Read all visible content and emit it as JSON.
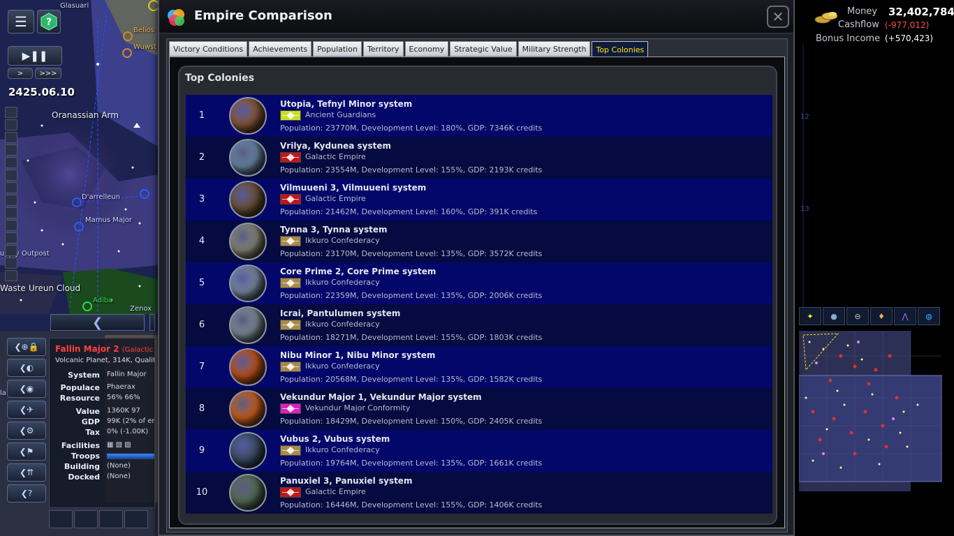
{
  "hud": {
    "date": "2425.06.10",
    "speed_slow": ">",
    "speed_fast": ">>>",
    "map_labels": {
      "oranassian_arm": "Oranassian Arm",
      "ureun_cloud": "Ureun Cloud",
      "waste": "Waste",
      "supply_outpost": "upply Outpost",
      "obarrelleun": "D'arrelleun",
      "mamus_major": "Mamus Major",
      "adiba": "Adiba",
      "glasuar": "Glasuari",
      "belios": "Belios",
      "wuwst": "Wuwst",
      "zenox": "Zenox",
      "la": "la"
    },
    "scroll_left": "❮"
  },
  "selection": {
    "title": "Fallin Major 2",
    "title_empire": "(Galactic Er",
    "subtitle": "Volcanic Planet, 314K, Quality: I",
    "rows": {
      "system_key": "System",
      "system_val": "Fallin Major",
      "populace_key": "Populace",
      "populace_val": "Phaerax",
      "resource_key": "Resource",
      "resource_val": "56%   66%",
      "value_key": "Value",
      "value_val": "1360K   97",
      "gdp_key": "GDP",
      "gdp_val": "99K (2% of em",
      "tax_key": "Tax",
      "tax_val": "0% (-1.00K)",
      "facilities_key": "Facilities",
      "troops_key": "Troops",
      "building_key": "Building",
      "building_val": "(None)",
      "docked_key": "Docked",
      "docked_val": "(None)"
    }
  },
  "finance": {
    "money_label": "Money",
    "money_value": "32,402,784",
    "cashflow_label": "Cashflow",
    "cashflow_value": "(-977,012)",
    "bonus_label": "Bonus Income",
    "bonus_value": "(+570,423)"
  },
  "dialog": {
    "title": "Empire Comparison",
    "close": "✕",
    "tabs": [
      {
        "label": "Victory Conditions"
      },
      {
        "label": "Achievements"
      },
      {
        "label": "Population"
      },
      {
        "label": "Territory"
      },
      {
        "label": "Economy"
      },
      {
        "label": "Strategic Value"
      },
      {
        "label": "Military Strength"
      },
      {
        "label": "Top Colonies"
      }
    ],
    "active_tab": "Top Colonies",
    "panel_title": "Top Colonies",
    "colonies": [
      {
        "rank": "1",
        "name": "Utopia, Tefnyl Minor system",
        "empire": "Ancient Guardians",
        "stats": "Population: 23770M,  Development Level: 180%,  GDP: 7346K credits",
        "planet_color": "#8a5a3a",
        "flag_color": "#c8e020"
      },
      {
        "rank": "2",
        "name": "Vrilya, Kydunea system",
        "empire": "Galactic Empire",
        "stats": "Population: 23554M,  Development Level: 155%,  GDP: 2193K credits",
        "planet_color": "#6c8aa8",
        "flag_color": "#c01818"
      },
      {
        "rank": "3",
        "name": "Vilmuueni 3, Vilmuueni system",
        "empire": "Galactic Empire",
        "stats": "Population: 21462M,  Development Level: 160%,  GDP: 391K credits",
        "planet_color": "#6e5438",
        "flag_color": "#c01818"
      },
      {
        "rank": "4",
        "name": "Tynna 3, Tynna system",
        "empire": "Ikkuro Confederacy",
        "stats": "Population: 23170M,  Development Level: 135%,  GDP: 3572K credits",
        "planet_color": "#8a8a7a",
        "flag_color": "#a88a4a"
      },
      {
        "rank": "5",
        "name": "Core Prime 2, Core Prime system",
        "empire": "Ikkuro Confederacy",
        "stats": "Population: 22359M,  Development Level: 135%,  GDP: 2006K credits",
        "planet_color": "#7a8ca0",
        "flag_color": "#a88a4a"
      },
      {
        "rank": "6",
        "name": "Icrai, Pantulumen system",
        "empire": "Ikkuro Confederacy",
        "stats": "Population: 18271M,  Development Level: 155%,  GDP: 1803K credits",
        "planet_color": "#7f8f98",
        "flag_color": "#a88a4a"
      },
      {
        "rank": "7",
        "name": "Nibu Minor 1, Nibu Minor system",
        "empire": "Ikkuro Confederacy",
        "stats": "Population: 20568M,  Development Level: 135%,  GDP: 1582K credits",
        "planet_color": "#c2541a",
        "flag_color": "#a88a4a"
      },
      {
        "rank": "8",
        "name": "Vekundur Major 1, Vekundur Major system",
        "empire": "Vekundur Major Conformity",
        "stats": "Population: 18429M,  Development Level: 150%,  GDP: 2405K credits",
        "planet_color": "#d06020",
        "flag_color": "#e020c0"
      },
      {
        "rank": "9",
        "name": "Vubus 2, Vubus system",
        "empire": "Ikkuro Confederacy",
        "stats": "Population: 19764M,  Development Level: 135%,  GDP: 1661K credits",
        "planet_color": "#3c5068",
        "flag_color": "#a88a4a"
      },
      {
        "rank": "10",
        "name": "Panuxiel 3, Panuxiel system",
        "empire": "Galactic Empire",
        "stats": "Population: 16446M,  Development Level: 155%,  GDP: 1406K credits",
        "planet_color": "#587058",
        "flag_color": "#c01818"
      }
    ]
  }
}
